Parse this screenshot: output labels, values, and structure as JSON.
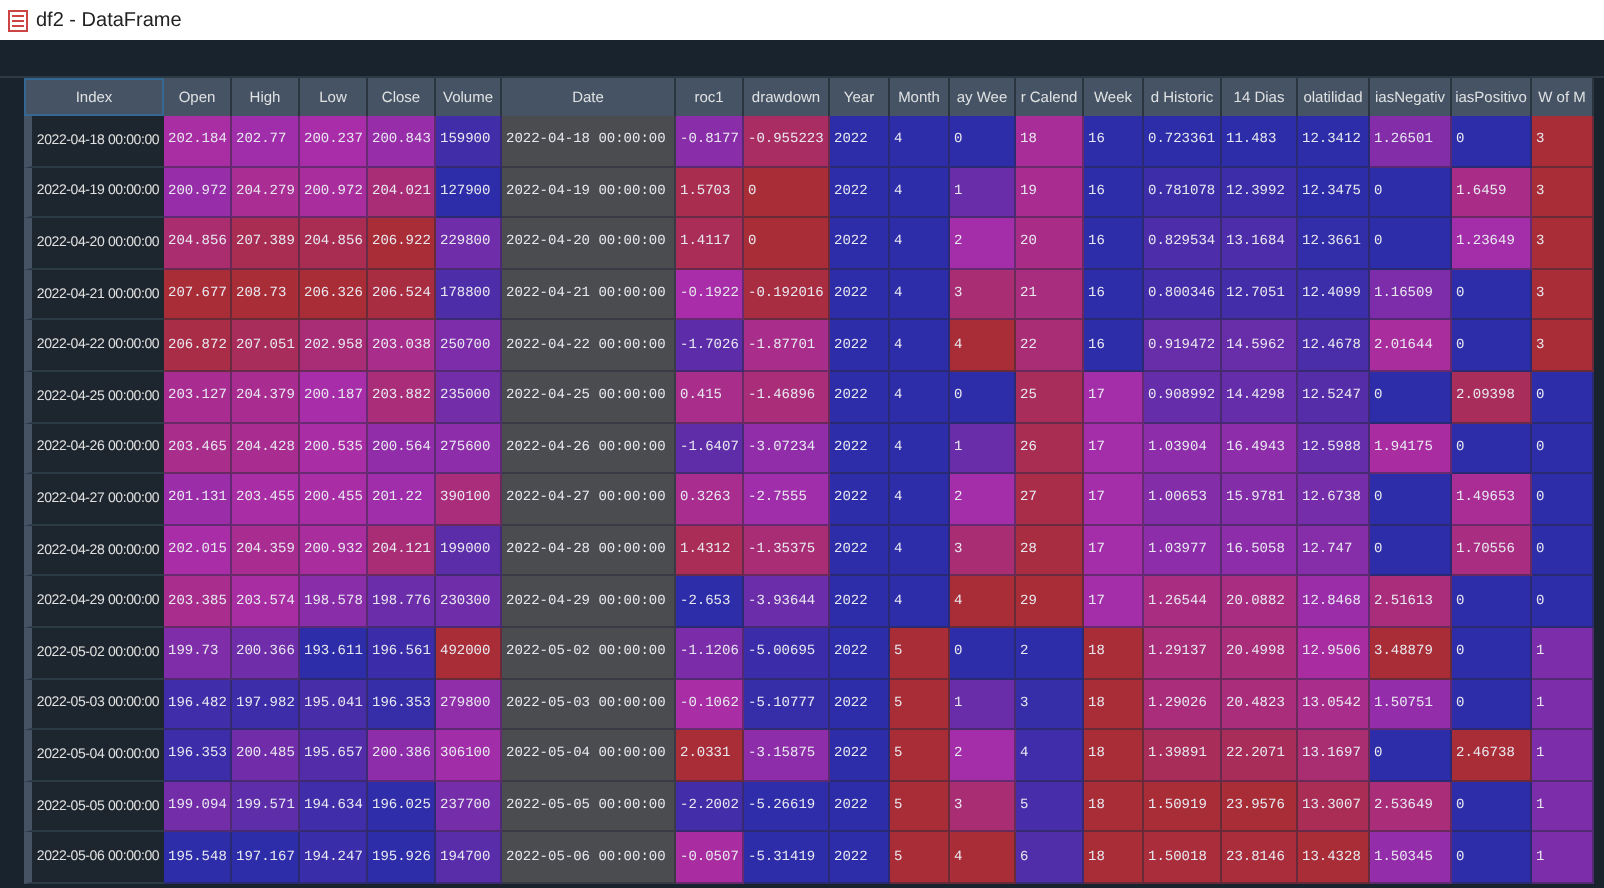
{
  "window": {
    "title": "df2 - DataFrame"
  },
  "table": {
    "index_header": "Index",
    "columns": [
      {
        "label": "Open",
        "kind": "number"
      },
      {
        "label": "High",
        "kind": "number"
      },
      {
        "label": "Low",
        "kind": "number"
      },
      {
        "label": "Close",
        "kind": "number"
      },
      {
        "label": "Volume",
        "kind": "number"
      },
      {
        "label": "Date",
        "kind": "text"
      },
      {
        "label": "roc1",
        "kind": "number"
      },
      {
        "label": "drawdown",
        "kind": "number"
      },
      {
        "label": "Year",
        "kind": "number"
      },
      {
        "label": "Month",
        "kind": "number"
      },
      {
        "label": "ay Wee",
        "kind": "number"
      },
      {
        "label": "r Calend",
        "kind": "number"
      },
      {
        "label": "Week",
        "kind": "number"
      },
      {
        "label": "d Historic",
        "kind": "number"
      },
      {
        "label": "14 Dias",
        "kind": "number"
      },
      {
        "label": "olatilidad",
        "kind": "number"
      },
      {
        "label": "iasNegativ",
        "kind": "number"
      },
      {
        "label": "iasPositivo",
        "kind": "number"
      },
      {
        "label": "W of M",
        "kind": "number"
      }
    ],
    "rows": [
      {
        "index": "2022-04-18 00:00:00",
        "cells": [
          "202.184",
          "202.77",
          "200.237",
          "200.843",
          "159900",
          "2022-04-18 00:00:00",
          "-0.8177",
          "-0.955223",
          "2022",
          "4",
          "0",
          "18",
          "16",
          "0.723361",
          "11.483",
          "12.3412",
          "1.26501",
          "0",
          "3"
        ]
      },
      {
        "index": "2022-04-19 00:00:00",
        "cells": [
          "200.972",
          "204.279",
          "200.972",
          "204.021",
          "127900",
          "2022-04-19 00:00:00",
          "1.5703",
          "0",
          "2022",
          "4",
          "1",
          "19",
          "16",
          "0.781078",
          "12.3992",
          "12.3475",
          "0",
          "1.6459",
          "3"
        ]
      },
      {
        "index": "2022-04-20 00:00:00",
        "cells": [
          "204.856",
          "207.389",
          "204.856",
          "206.922",
          "229800",
          "2022-04-20 00:00:00",
          "1.4117",
          "0",
          "2022",
          "4",
          "2",
          "20",
          "16",
          "0.829534",
          "13.1684",
          "12.3661",
          "0",
          "1.23649",
          "3"
        ]
      },
      {
        "index": "2022-04-21 00:00:00",
        "cells": [
          "207.677",
          "208.73",
          "206.326",
          "206.524",
          "178800",
          "2022-04-21 00:00:00",
          "-0.1922",
          "-0.192016",
          "2022",
          "4",
          "3",
          "21",
          "16",
          "0.800346",
          "12.7051",
          "12.4099",
          "1.16509",
          "0",
          "3"
        ]
      },
      {
        "index": "2022-04-22 00:00:00",
        "cells": [
          "206.872",
          "207.051",
          "202.958",
          "203.038",
          "250700",
          "2022-04-22 00:00:00",
          "-1.7026",
          "-1.87701",
          "2022",
          "4",
          "4",
          "22",
          "16",
          "0.919472",
          "14.5962",
          "12.4678",
          "2.01644",
          "0",
          "3"
        ]
      },
      {
        "index": "2022-04-25 00:00:00",
        "cells": [
          "203.127",
          "204.379",
          "200.187",
          "203.882",
          "235000",
          "2022-04-25 00:00:00",
          "0.415",
          "-1.46896",
          "2022",
          "4",
          "0",
          "25",
          "17",
          "0.908992",
          "14.4298",
          "12.5247",
          "0",
          "2.09398",
          "0"
        ]
      },
      {
        "index": "2022-04-26 00:00:00",
        "cells": [
          "203.465",
          "204.428",
          "200.535",
          "200.564",
          "275600",
          "2022-04-26 00:00:00",
          "-1.6407",
          "-3.07234",
          "2022",
          "4",
          "1",
          "26",
          "17",
          "1.03904",
          "16.4943",
          "12.5988",
          "1.94175",
          "0",
          "0"
        ]
      },
      {
        "index": "2022-04-27 00:00:00",
        "cells": [
          "201.131",
          "203.455",
          "200.455",
          "201.22",
          "390100",
          "2022-04-27 00:00:00",
          "0.3263",
          "-2.7555",
          "2022",
          "4",
          "2",
          "27",
          "17",
          "1.00653",
          "15.9781",
          "12.6738",
          "0",
          "1.49653",
          "0"
        ]
      },
      {
        "index": "2022-04-28 00:00:00",
        "cells": [
          "202.015",
          "204.359",
          "200.932",
          "204.121",
          "199000",
          "2022-04-28 00:00:00",
          "1.4312",
          "-1.35375",
          "2022",
          "4",
          "3",
          "28",
          "17",
          "1.03977",
          "16.5058",
          "12.747",
          "0",
          "1.70556",
          "0"
        ]
      },
      {
        "index": "2022-04-29 00:00:00",
        "cells": [
          "203.385",
          "203.574",
          "198.578",
          "198.776",
          "230300",
          "2022-04-29 00:00:00",
          "-2.653",
          "-3.93644",
          "2022",
          "4",
          "4",
          "29",
          "17",
          "1.26544",
          "20.0882",
          "12.8468",
          "2.51613",
          "0",
          "0"
        ]
      },
      {
        "index": "2022-05-02 00:00:00",
        "cells": [
          "199.73",
          "200.366",
          "193.611",
          "196.561",
          "492000",
          "2022-05-02 00:00:00",
          "-1.1206",
          "-5.00695",
          "2022",
          "5",
          "0",
          "2",
          "18",
          "1.29137",
          "20.4998",
          "12.9506",
          "3.48879",
          "0",
          "1"
        ]
      },
      {
        "index": "2022-05-03 00:00:00",
        "cells": [
          "196.482",
          "197.982",
          "195.041",
          "196.353",
          "279800",
          "2022-05-03 00:00:00",
          "-0.1062",
          "-5.10777",
          "2022",
          "5",
          "1",
          "3",
          "18",
          "1.29026",
          "20.4823",
          "13.0542",
          "1.50751",
          "0",
          "1"
        ]
      },
      {
        "index": "2022-05-04 00:00:00",
        "cells": [
          "196.353",
          "200.485",
          "195.657",
          "200.386",
          "306100",
          "2022-05-04 00:00:00",
          "2.0331",
          "-3.15875",
          "2022",
          "5",
          "2",
          "4",
          "18",
          "1.39891",
          "22.2071",
          "13.1697",
          "0",
          "2.46738",
          "1"
        ]
      },
      {
        "index": "2022-05-05 00:00:00",
        "cells": [
          "199.094",
          "199.571",
          "194.634",
          "196.025",
          "237700",
          "2022-05-05 00:00:00",
          "-2.2002",
          "-5.26619",
          "2022",
          "5",
          "3",
          "5",
          "18",
          "1.50919",
          "23.9576",
          "13.3007",
          "2.53649",
          "0",
          "1"
        ]
      },
      {
        "index": "2022-05-06 00:00:00",
        "cells": [
          "195.548",
          "197.167",
          "194.247",
          "195.926",
          "194700",
          "2022-05-06 00:00:00",
          "-0.0507",
          "-5.31419",
          "2022",
          "5",
          "4",
          "6",
          "18",
          "1.50018",
          "23.8146",
          "13.4328",
          "1.50345",
          "0",
          "1"
        ]
      }
    ]
  }
}
